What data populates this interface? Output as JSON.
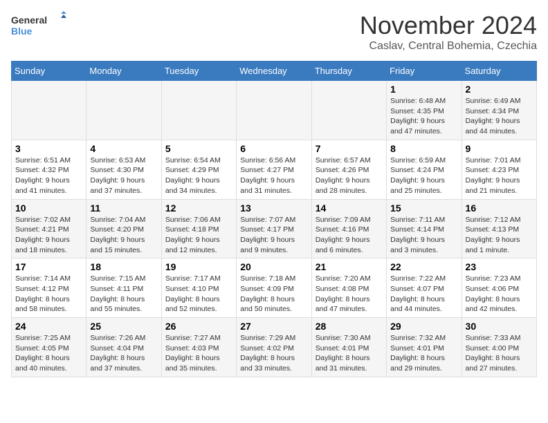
{
  "logo": {
    "line1": "General",
    "line2": "Blue"
  },
  "title": "November 2024",
  "location": "Caslav, Central Bohemia, Czechia",
  "days_of_week": [
    "Sunday",
    "Monday",
    "Tuesday",
    "Wednesday",
    "Thursday",
    "Friday",
    "Saturday"
  ],
  "weeks": [
    [
      {
        "day": "",
        "info": ""
      },
      {
        "day": "",
        "info": ""
      },
      {
        "day": "",
        "info": ""
      },
      {
        "day": "",
        "info": ""
      },
      {
        "day": "",
        "info": ""
      },
      {
        "day": "1",
        "info": "Sunrise: 6:48 AM\nSunset: 4:35 PM\nDaylight: 9 hours and 47 minutes."
      },
      {
        "day": "2",
        "info": "Sunrise: 6:49 AM\nSunset: 4:34 PM\nDaylight: 9 hours and 44 minutes."
      }
    ],
    [
      {
        "day": "3",
        "info": "Sunrise: 6:51 AM\nSunset: 4:32 PM\nDaylight: 9 hours and 41 minutes."
      },
      {
        "day": "4",
        "info": "Sunrise: 6:53 AM\nSunset: 4:30 PM\nDaylight: 9 hours and 37 minutes."
      },
      {
        "day": "5",
        "info": "Sunrise: 6:54 AM\nSunset: 4:29 PM\nDaylight: 9 hours and 34 minutes."
      },
      {
        "day": "6",
        "info": "Sunrise: 6:56 AM\nSunset: 4:27 PM\nDaylight: 9 hours and 31 minutes."
      },
      {
        "day": "7",
        "info": "Sunrise: 6:57 AM\nSunset: 4:26 PM\nDaylight: 9 hours and 28 minutes."
      },
      {
        "day": "8",
        "info": "Sunrise: 6:59 AM\nSunset: 4:24 PM\nDaylight: 9 hours and 25 minutes."
      },
      {
        "day": "9",
        "info": "Sunrise: 7:01 AM\nSunset: 4:23 PM\nDaylight: 9 hours and 21 minutes."
      }
    ],
    [
      {
        "day": "10",
        "info": "Sunrise: 7:02 AM\nSunset: 4:21 PM\nDaylight: 9 hours and 18 minutes."
      },
      {
        "day": "11",
        "info": "Sunrise: 7:04 AM\nSunset: 4:20 PM\nDaylight: 9 hours and 15 minutes."
      },
      {
        "day": "12",
        "info": "Sunrise: 7:06 AM\nSunset: 4:18 PM\nDaylight: 9 hours and 12 minutes."
      },
      {
        "day": "13",
        "info": "Sunrise: 7:07 AM\nSunset: 4:17 PM\nDaylight: 9 hours and 9 minutes."
      },
      {
        "day": "14",
        "info": "Sunrise: 7:09 AM\nSunset: 4:16 PM\nDaylight: 9 hours and 6 minutes."
      },
      {
        "day": "15",
        "info": "Sunrise: 7:11 AM\nSunset: 4:14 PM\nDaylight: 9 hours and 3 minutes."
      },
      {
        "day": "16",
        "info": "Sunrise: 7:12 AM\nSunset: 4:13 PM\nDaylight: 9 hours and 1 minute."
      }
    ],
    [
      {
        "day": "17",
        "info": "Sunrise: 7:14 AM\nSunset: 4:12 PM\nDaylight: 8 hours and 58 minutes."
      },
      {
        "day": "18",
        "info": "Sunrise: 7:15 AM\nSunset: 4:11 PM\nDaylight: 8 hours and 55 minutes."
      },
      {
        "day": "19",
        "info": "Sunrise: 7:17 AM\nSunset: 4:10 PM\nDaylight: 8 hours and 52 minutes."
      },
      {
        "day": "20",
        "info": "Sunrise: 7:18 AM\nSunset: 4:09 PM\nDaylight: 8 hours and 50 minutes."
      },
      {
        "day": "21",
        "info": "Sunrise: 7:20 AM\nSunset: 4:08 PM\nDaylight: 8 hours and 47 minutes."
      },
      {
        "day": "22",
        "info": "Sunrise: 7:22 AM\nSunset: 4:07 PM\nDaylight: 8 hours and 44 minutes."
      },
      {
        "day": "23",
        "info": "Sunrise: 7:23 AM\nSunset: 4:06 PM\nDaylight: 8 hours and 42 minutes."
      }
    ],
    [
      {
        "day": "24",
        "info": "Sunrise: 7:25 AM\nSunset: 4:05 PM\nDaylight: 8 hours and 40 minutes."
      },
      {
        "day": "25",
        "info": "Sunrise: 7:26 AM\nSunset: 4:04 PM\nDaylight: 8 hours and 37 minutes."
      },
      {
        "day": "26",
        "info": "Sunrise: 7:27 AM\nSunset: 4:03 PM\nDaylight: 8 hours and 35 minutes."
      },
      {
        "day": "27",
        "info": "Sunrise: 7:29 AM\nSunset: 4:02 PM\nDaylight: 8 hours and 33 minutes."
      },
      {
        "day": "28",
        "info": "Sunrise: 7:30 AM\nSunset: 4:01 PM\nDaylight: 8 hours and 31 minutes."
      },
      {
        "day": "29",
        "info": "Sunrise: 7:32 AM\nSunset: 4:01 PM\nDaylight: 8 hours and 29 minutes."
      },
      {
        "day": "30",
        "info": "Sunrise: 7:33 AM\nSunset: 4:00 PM\nDaylight: 8 hours and 27 minutes."
      }
    ]
  ]
}
